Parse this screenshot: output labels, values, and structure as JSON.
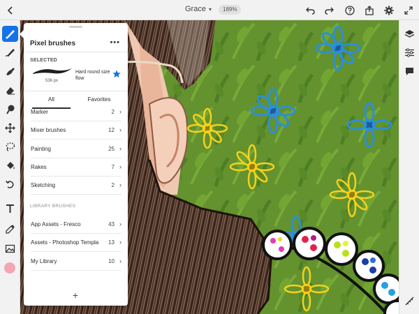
{
  "topbar": {
    "doc_title": "Grace",
    "zoom": "189%",
    "icons": [
      "back-chevron-icon",
      "undo-icon",
      "redo-icon",
      "help-icon",
      "share-icon",
      "settings-icon",
      "fullscreen-icon"
    ]
  },
  "left_tools": [
    "pixel-brush-icon",
    "live-brush-icon",
    "vector-brush-icon",
    "eraser-icon",
    "smudge-icon",
    "move-transform-icon",
    "lasso-selection-icon",
    "fill-icon",
    "liquify-icon",
    "text-icon",
    "eyedropper-icon",
    "place-image-icon"
  ],
  "current_color": "#f4a5b4",
  "right_tools": [
    "layers-icon",
    "layer-properties-icon",
    "comments-icon",
    "rotate-canvas-icon"
  ],
  "accent_color": "#1473e6",
  "panel": {
    "title": "Pixel brushes",
    "more": "•••",
    "selected_label": "SELECTED",
    "selected_size": "536 px",
    "selected_brush_name": "Hard round size flow",
    "tabs": [
      {
        "label": "All",
        "active": true
      },
      {
        "label": "Favorites",
        "active": false
      }
    ],
    "groups": [
      {
        "label": "Marker",
        "count": "2"
      },
      {
        "label": "Mixer brushes",
        "count": "12"
      },
      {
        "label": "Painting",
        "count": "25"
      },
      {
        "label": "Rakes",
        "count": "7"
      },
      {
        "label": "Sketching",
        "count": "2"
      }
    ],
    "library_label": "LIBRARY BRUSHES",
    "libraries": [
      {
        "label": "App Assets - Fresco",
        "count": "43"
      },
      {
        "label": "Assets - Photoshop Templa...",
        "count": "13"
      },
      {
        "label": "My Library",
        "count": "10"
      }
    ],
    "add": "+"
  }
}
